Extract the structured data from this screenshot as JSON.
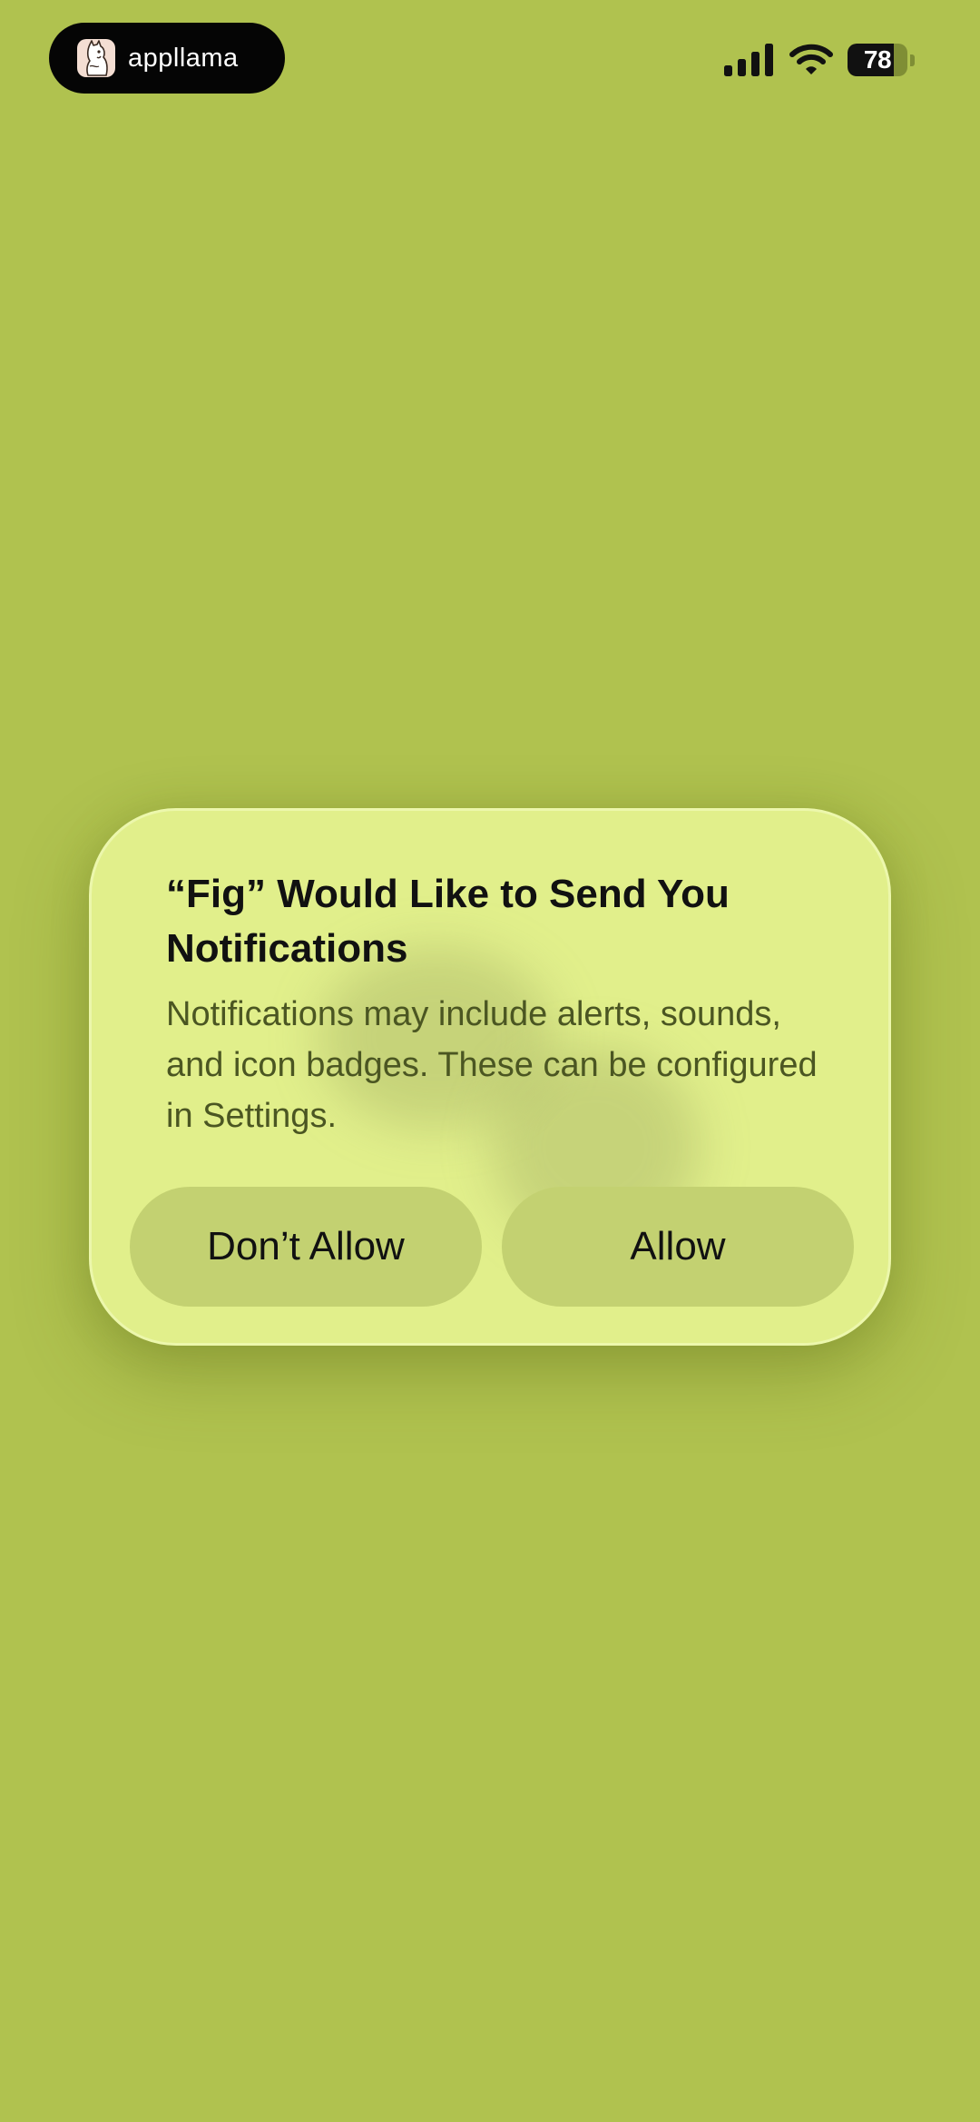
{
  "status_bar": {
    "app_badge": {
      "icon": "llama-icon",
      "name": "appllama"
    },
    "signal_icon": "cellular-signal-icon",
    "wifi_icon": "wifi-icon",
    "battery": {
      "level": "78",
      "level_fraction": 0.78
    }
  },
  "alert": {
    "title": "“Fig” Would Like to Send You Notifications",
    "message": "Notifications may include alerts, sounds, and icon badges. These can be configured in Settings.",
    "buttons": {
      "deny_label": "Don’t Allow",
      "allow_label": "Allow"
    }
  },
  "colors": {
    "background": "#b0c24f",
    "alert_background": "#e1ef8b",
    "button_background": "#c3d171",
    "title_text": "#111111",
    "message_text": "#4b5622"
  }
}
